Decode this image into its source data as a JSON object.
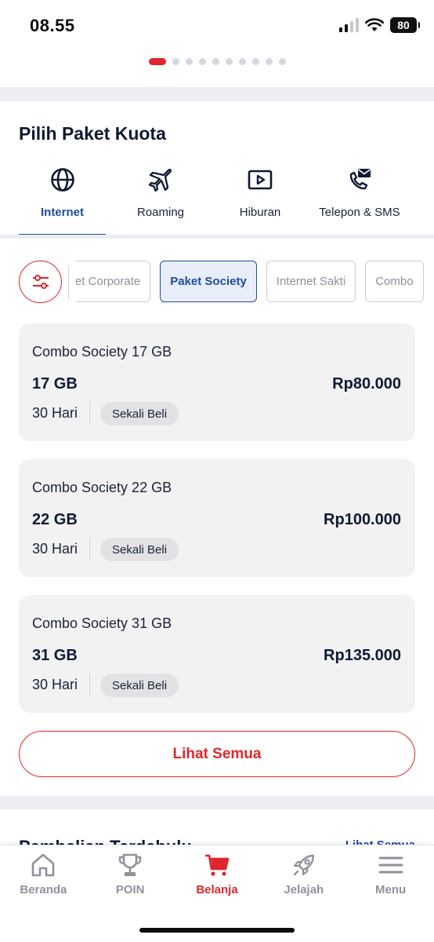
{
  "status_bar": {
    "time": "08.55",
    "battery": "80"
  },
  "pager": {
    "count": 10,
    "active_index": 0
  },
  "section": {
    "title": "Pilih Paket Kuota"
  },
  "category_tabs": [
    {
      "label": "Internet",
      "icon": "globe-icon",
      "active": true
    },
    {
      "label": "Roaming",
      "icon": "airplane-icon",
      "active": false
    },
    {
      "label": "Hiburan",
      "icon": "play-icon",
      "active": false
    },
    {
      "label": "Telepon & SMS",
      "icon": "phone-message-icon",
      "active": false
    }
  ],
  "filter": {
    "icon": "sliders-icon",
    "chips": [
      {
        "label": "Paket Corporate",
        "active": false
      },
      {
        "label": "Paket Society",
        "active": true
      },
      {
        "label": "Internet Sakti",
        "active": false
      },
      {
        "label": "Combo",
        "active": false
      }
    ]
  },
  "packages": [
    {
      "name": "Combo Society 17 GB",
      "quota": "17 GB",
      "price": "Rp80.000",
      "duration": "30 Hari",
      "badge": "Sekali Beli"
    },
    {
      "name": "Combo Society 22 GB",
      "quota": "22 GB",
      "price": "Rp100.000",
      "duration": "30 Hari",
      "badge": "Sekali Beli"
    },
    {
      "name": "Combo Society 31 GB",
      "quota": "31 GB",
      "price": "Rp135.000",
      "duration": "30 Hari",
      "badge": "Sekali Beli"
    }
  ],
  "see_all_label": "Lihat Semua",
  "next_section": {
    "title": "Pembelian Terdahulu",
    "link": "Lihat Semua"
  },
  "bottom_nav": [
    {
      "label": "Beranda",
      "icon": "home-icon",
      "active": false
    },
    {
      "label": "POIN",
      "icon": "trophy-icon",
      "active": false
    },
    {
      "label": "Belanja",
      "icon": "cart-icon",
      "active": true
    },
    {
      "label": "Jelajah",
      "icon": "rocket-icon",
      "active": false
    },
    {
      "label": "Menu",
      "icon": "hamburger-icon",
      "active": false
    }
  ],
  "colors": {
    "accent_red": "#e0262b",
    "accent_blue": "#1d4ba0",
    "card_bg": "#f3f2f3"
  }
}
